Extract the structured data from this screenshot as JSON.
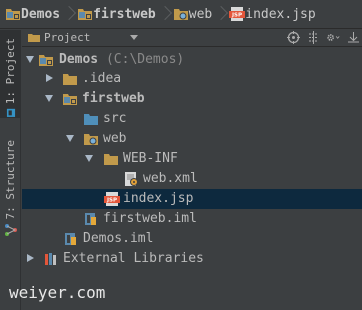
{
  "breadcrumb": [
    {
      "label": "Demos",
      "icon": "module-folder-icon"
    },
    {
      "label": "firstweb",
      "icon": "module-folder-icon"
    },
    {
      "label": "web",
      "icon": "web-folder-icon"
    },
    {
      "label": "index.jsp",
      "icon": "jsp-file-icon"
    }
  ],
  "stripe": {
    "project_label": "1: Project",
    "structure_label": "7: Structure"
  },
  "panel": {
    "view_selector": "Project",
    "tools": [
      "target-icon",
      "collapse-all-icon",
      "settings-icon",
      "hide-icon"
    ]
  },
  "tree": {
    "rows": [
      {
        "label": "Demos",
        "path": " (C:\\Demos)",
        "bold": true,
        "icon": "module-folder-icon"
      },
      {
        "label": ".idea",
        "icon": "folder-icon"
      },
      {
        "label": "firstweb",
        "bold": true,
        "icon": "module-folder-icon"
      },
      {
        "label": "src",
        "icon": "source-folder-icon"
      },
      {
        "label": "web",
        "icon": "web-folder-icon"
      },
      {
        "label": "WEB-INF",
        "icon": "folder-icon"
      },
      {
        "label": "web.xml",
        "icon": "web-xml-file-icon"
      },
      {
        "label": "index.jsp",
        "icon": "jsp-file-icon"
      },
      {
        "label": "firstweb.iml",
        "icon": "iml-file-icon"
      },
      {
        "label": "Demos.iml",
        "icon": "iml-file-icon"
      },
      {
        "label": "External Libraries",
        "icon": "libraries-icon"
      }
    ]
  },
  "watermark": "weiyer.com",
  "colors": {
    "background": "#3c3f41",
    "selection": "#0d293e",
    "folder": "#c19a4b",
    "source_folder": "#4f8fba",
    "jsp": "#e3563a"
  }
}
